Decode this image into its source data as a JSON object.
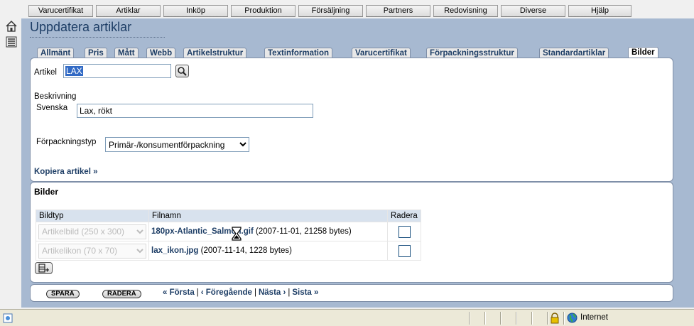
{
  "topnav": {
    "items": [
      "Varucertifikat",
      "Artiklar",
      "Inköp",
      "Produktion",
      "Försäljning",
      "Partners",
      "Redovisning",
      "Diverse",
      "Hjälp"
    ]
  },
  "sidebar": {
    "icons": [
      "home-icon",
      "list-icon"
    ]
  },
  "page": {
    "title": "Uppdatera artiklar"
  },
  "tabs": [
    {
      "label": "Allmänt"
    },
    {
      "label": "Pris"
    },
    {
      "label": "Mått"
    },
    {
      "label": "Webb"
    },
    {
      "label": "Artikelstruktur"
    },
    {
      "label": "Textinformation"
    },
    {
      "label": "Varucertifikat"
    },
    {
      "label": "Förpackningsstruktur"
    },
    {
      "label": "Standardartiklar"
    },
    {
      "label": "Bilder",
      "active": true
    }
  ],
  "form": {
    "artikel_label": "Artikel",
    "artikel_value": "LAX",
    "beskrivning_label": "Beskrivning",
    "svenska_label": "Svenska",
    "svenska_value": "Lax, rökt",
    "forpackning_label": "Förpackningstyp",
    "forpackning_value": "Primär-/konsumentförpackning",
    "kopiera_link": "Kopiera artikel »"
  },
  "bilder": {
    "title": "Bilder",
    "headers": {
      "bildtyp": "Bildtyp",
      "filnamn": "Filnamn",
      "radera": "Radera"
    },
    "rows": [
      {
        "bildtyp": "Artikelbild (250 x 300)",
        "filename": "180px-Atlantic_Salmon.gif",
        "meta": "(2007-11-01, 21258 bytes)"
      },
      {
        "bildtyp": "Artikelikon (70 x 70)",
        "filename": "lax_ikon.jpg",
        "meta": "(2007-11-14, 1228 bytes)"
      }
    ]
  },
  "footer": {
    "spara": "SPARA",
    "radera": "RADERA",
    "first": "« Första",
    "prev": "‹ Föregående",
    "next": "Nästa ›",
    "last": "Sista »"
  },
  "statusbar": {
    "zone": "Internet"
  }
}
